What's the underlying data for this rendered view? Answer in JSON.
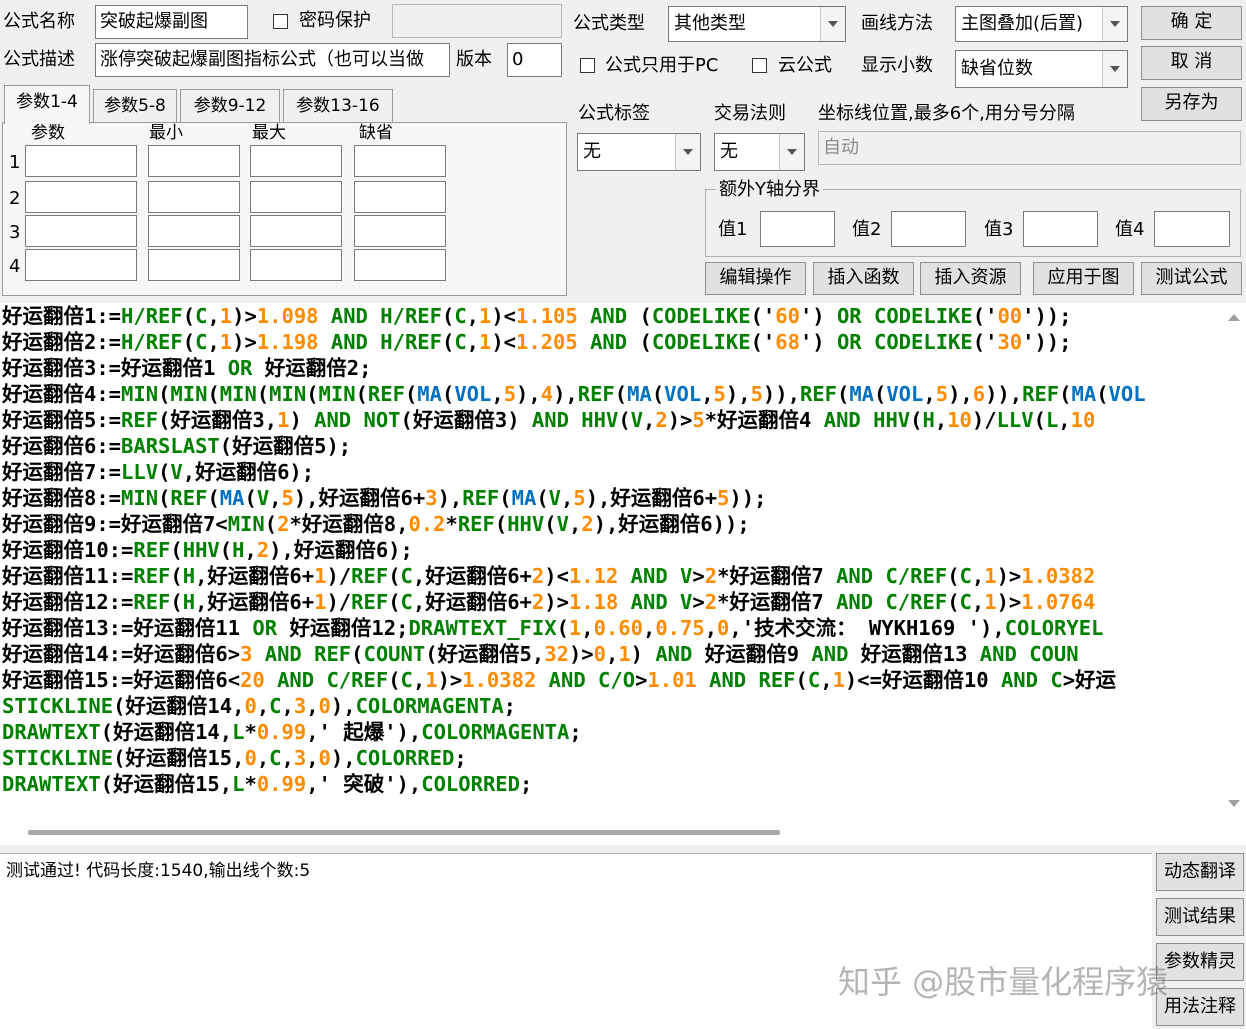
{
  "header": {
    "name_label": "公式名称",
    "name_value": "突破起爆副图",
    "password_label": "密码保护",
    "password_value": "",
    "desc_label": "公式描述",
    "desc_value": "涨停突破起爆副图指标公式（也可以当做",
    "version_label": "版本",
    "version_value": "0",
    "type_label": "公式类型",
    "type_value": "其他类型",
    "draw_label": "画线方法",
    "draw_value": "主图叠加(后置)",
    "pc_only_label": "公式只用于PC",
    "cloud_label": "云公式",
    "decimal_label": "显示小数",
    "decimal_value": "缺省位数",
    "confirm_label": "确  定",
    "cancel_label": "取  消",
    "saveas_label": "另存为"
  },
  "params": {
    "tabs": [
      "参数1-4",
      "参数5-8",
      "参数9-12",
      "参数13-16"
    ],
    "columns": [
      "参数",
      "最小",
      "最大",
      "缺省"
    ],
    "rows": [
      "1",
      "2",
      "3",
      "4"
    ]
  },
  "options": {
    "tag_label": "公式标签",
    "tag_value": "无",
    "rule_label": "交易法则",
    "rule_value": "无",
    "axis_label": "坐标线位置,最多6个,用分号分隔",
    "axis_value": "自动",
    "extra_group": "额外Y轴分界",
    "v1_label": "值1",
    "v2_label": "值2",
    "v3_label": "值3",
    "v4_label": "值4"
  },
  "toolbar": {
    "edit_label": "编辑操作",
    "insert_func_label": "插入函数",
    "insert_res_label": "插入资源",
    "apply_label": "应用于图",
    "test_label": "测试公式"
  },
  "code_lines": [
    [
      [
        "c",
        "好运翻倍1:="
      ],
      [
        "k",
        "H/"
      ],
      [
        "k",
        "REF"
      ],
      [
        "c",
        "("
      ],
      [
        "k",
        "C"
      ],
      [
        "c",
        ","
      ],
      [
        "n",
        "1"
      ],
      [
        "c",
        ")>"
      ],
      [
        "n",
        "1.098"
      ],
      [
        "k",
        " AND "
      ],
      [
        "k",
        "H/"
      ],
      [
        "k",
        "REF"
      ],
      [
        "c",
        "("
      ],
      [
        "k",
        "C"
      ],
      [
        "c",
        ","
      ],
      [
        "n",
        "1"
      ],
      [
        "c",
        ")<"
      ],
      [
        "n",
        "1.105"
      ],
      [
        "k",
        " AND "
      ],
      [
        "c",
        "("
      ],
      [
        "k",
        "CODELIKE"
      ],
      [
        "c",
        "('"
      ],
      [
        "n",
        "60"
      ],
      [
        "c",
        "')"
      ],
      [
        "k",
        " OR "
      ],
      [
        "k",
        "CODELIKE"
      ],
      [
        "c",
        "('"
      ],
      [
        "n",
        "00"
      ],
      [
        "c",
        "'));"
      ]
    ],
    [
      [
        "c",
        "好运翻倍2:="
      ],
      [
        "k",
        "H/"
      ],
      [
        "k",
        "REF"
      ],
      [
        "c",
        "("
      ],
      [
        "k",
        "C"
      ],
      [
        "c",
        ","
      ],
      [
        "n",
        "1"
      ],
      [
        "c",
        ")>"
      ],
      [
        "n",
        "1.198"
      ],
      [
        "k",
        " AND "
      ],
      [
        "k",
        "H/"
      ],
      [
        "k",
        "REF"
      ],
      [
        "c",
        "("
      ],
      [
        "k",
        "C"
      ],
      [
        "c",
        ","
      ],
      [
        "n",
        "1"
      ],
      [
        "c",
        ")<"
      ],
      [
        "n",
        "1.205"
      ],
      [
        "k",
        " AND "
      ],
      [
        "c",
        "("
      ],
      [
        "k",
        "CODELIKE"
      ],
      [
        "c",
        "('"
      ],
      [
        "n",
        "68"
      ],
      [
        "c",
        "')"
      ],
      [
        "k",
        " OR "
      ],
      [
        "k",
        "CODELIKE"
      ],
      [
        "c",
        "('"
      ],
      [
        "n",
        "30"
      ],
      [
        "c",
        "'));"
      ]
    ],
    [
      [
        "c",
        "好运翻倍3:=好运翻倍1"
      ],
      [
        "k",
        " OR "
      ],
      [
        "c",
        "好运翻倍2;"
      ]
    ],
    [
      [
        "c",
        "好运翻倍4:="
      ],
      [
        "k",
        "MIN"
      ],
      [
        "c",
        "("
      ],
      [
        "k",
        "MIN"
      ],
      [
        "c",
        "("
      ],
      [
        "k",
        "MIN"
      ],
      [
        "c",
        "("
      ],
      [
        "k",
        "MIN"
      ],
      [
        "c",
        "("
      ],
      [
        "k",
        "MIN"
      ],
      [
        "c",
        "("
      ],
      [
        "k",
        "REF"
      ],
      [
        "c",
        "("
      ],
      [
        "f",
        "MA"
      ],
      [
        "c",
        "("
      ],
      [
        "f",
        "VOL"
      ],
      [
        "c",
        ","
      ],
      [
        "n",
        "5"
      ],
      [
        "c",
        "),"
      ],
      [
        "n",
        "4"
      ],
      [
        "c",
        "),"
      ],
      [
        "k",
        "REF"
      ],
      [
        "c",
        "("
      ],
      [
        "f",
        "MA"
      ],
      [
        "c",
        "("
      ],
      [
        "f",
        "VOL"
      ],
      [
        "c",
        ","
      ],
      [
        "n",
        "5"
      ],
      [
        "c",
        "),"
      ],
      [
        "n",
        "5"
      ],
      [
        "c",
        "))"
      ],
      [
        "c",
        ","
      ],
      [
        "k",
        "REF"
      ],
      [
        "c",
        "("
      ],
      [
        "f",
        "MA"
      ],
      [
        "c",
        "("
      ],
      [
        "f",
        "VOL"
      ],
      [
        "c",
        ","
      ],
      [
        "n",
        "5"
      ],
      [
        "c",
        "),"
      ],
      [
        "n",
        "6"
      ],
      [
        "c",
        "))"
      ],
      [
        "c",
        ","
      ],
      [
        "k",
        "REF"
      ],
      [
        "c",
        "("
      ],
      [
        "f",
        "MA"
      ],
      [
        "c",
        "("
      ],
      [
        "f",
        "VOL"
      ]
    ],
    [
      [
        "c",
        "好运翻倍5:="
      ],
      [
        "k",
        "REF"
      ],
      [
        "c",
        "(好运翻倍3,"
      ],
      [
        "n",
        "1"
      ],
      [
        "c",
        ")"
      ],
      [
        "k",
        " AND NOT"
      ],
      [
        "c",
        "(好运翻倍3)"
      ],
      [
        "k",
        " AND "
      ],
      [
        "k",
        "HHV"
      ],
      [
        "c",
        "("
      ],
      [
        "k",
        "V"
      ],
      [
        "c",
        ","
      ],
      [
        "n",
        "2"
      ],
      [
        "c",
        ")>"
      ],
      [
        "n",
        "5"
      ],
      [
        "c",
        "*好运翻倍4"
      ],
      [
        "k",
        " AND "
      ],
      [
        "k",
        "HHV"
      ],
      [
        "c",
        "("
      ],
      [
        "k",
        "H"
      ],
      [
        "c",
        ","
      ],
      [
        "n",
        "10"
      ],
      [
        "c",
        ")/"
      ],
      [
        "k",
        "LLV"
      ],
      [
        "c",
        "("
      ],
      [
        "k",
        "L"
      ],
      [
        "c",
        ","
      ],
      [
        "n",
        "10"
      ]
    ],
    [
      [
        "c",
        "好运翻倍6:="
      ],
      [
        "k",
        "BARSLAST"
      ],
      [
        "c",
        "(好运翻倍5);"
      ]
    ],
    [
      [
        "c",
        "好运翻倍7:="
      ],
      [
        "k",
        "LLV"
      ],
      [
        "c",
        "("
      ],
      [
        "k",
        "V"
      ],
      [
        "c",
        ",好运翻倍6);"
      ]
    ],
    [
      [
        "c",
        "好运翻倍8:="
      ],
      [
        "k",
        "MIN"
      ],
      [
        "c",
        "("
      ],
      [
        "k",
        "REF"
      ],
      [
        "c",
        "("
      ],
      [
        "f",
        "MA"
      ],
      [
        "c",
        "("
      ],
      [
        "k",
        "V"
      ],
      [
        "c",
        ","
      ],
      [
        "n",
        "5"
      ],
      [
        "c",
        "),好运翻倍6+"
      ],
      [
        "n",
        "3"
      ],
      [
        "c",
        "),"
      ],
      [
        "k",
        "REF"
      ],
      [
        "c",
        "("
      ],
      [
        "f",
        "MA"
      ],
      [
        "c",
        "("
      ],
      [
        "k",
        "V"
      ],
      [
        "c",
        ","
      ],
      [
        "n",
        "5"
      ],
      [
        "c",
        "),好运翻倍6+"
      ],
      [
        "n",
        "5"
      ],
      [
        "c",
        "));"
      ]
    ],
    [
      [
        "c",
        "好运翻倍9:=好运翻倍7<"
      ],
      [
        "k",
        "MIN"
      ],
      [
        "c",
        "("
      ],
      [
        "n",
        "2"
      ],
      [
        "c",
        "*好运翻倍8,"
      ],
      [
        "n",
        "0.2"
      ],
      [
        "c",
        "*"
      ],
      [
        "k",
        "REF"
      ],
      [
        "c",
        "("
      ],
      [
        "k",
        "HHV"
      ],
      [
        "c",
        "("
      ],
      [
        "k",
        "V"
      ],
      [
        "c",
        ","
      ],
      [
        "n",
        "2"
      ],
      [
        "c",
        "),好运翻倍6));"
      ]
    ],
    [
      [
        "c",
        "好运翻倍10:="
      ],
      [
        "k",
        "REF"
      ],
      [
        "c",
        "("
      ],
      [
        "k",
        "HHV"
      ],
      [
        "c",
        "("
      ],
      [
        "k",
        "H"
      ],
      [
        "c",
        ","
      ],
      [
        "n",
        "2"
      ],
      [
        "c",
        "),好运翻倍6);"
      ]
    ],
    [
      [
        "c",
        "好运翻倍11:="
      ],
      [
        "k",
        "REF"
      ],
      [
        "c",
        "("
      ],
      [
        "k",
        "H"
      ],
      [
        "c",
        ",好运翻倍6+"
      ],
      [
        "n",
        "1"
      ],
      [
        "c",
        ")/"
      ],
      [
        "k",
        "REF"
      ],
      [
        "c",
        "("
      ],
      [
        "k",
        "C"
      ],
      [
        "c",
        ",好运翻倍6+"
      ],
      [
        "n",
        "2"
      ],
      [
        "c",
        ")<"
      ],
      [
        "n",
        "1.12"
      ],
      [
        "k",
        " AND "
      ],
      [
        "k",
        "V"
      ],
      [
        "c",
        ">"
      ],
      [
        "n",
        "2"
      ],
      [
        "c",
        "*好运翻倍7"
      ],
      [
        "k",
        " AND "
      ],
      [
        "k",
        "C/"
      ],
      [
        "k",
        "REF"
      ],
      [
        "c",
        "("
      ],
      [
        "k",
        "C"
      ],
      [
        "c",
        ","
      ],
      [
        "n",
        "1"
      ],
      [
        "c",
        ")>"
      ],
      [
        "n",
        "1.0382"
      ]
    ],
    [
      [
        "c",
        "好运翻倍12:="
      ],
      [
        "k",
        "REF"
      ],
      [
        "c",
        "("
      ],
      [
        "k",
        "H"
      ],
      [
        "c",
        ",好运翻倍6+"
      ],
      [
        "n",
        "1"
      ],
      [
        "c",
        ")/"
      ],
      [
        "k",
        "REF"
      ],
      [
        "c",
        "("
      ],
      [
        "k",
        "C"
      ],
      [
        "c",
        ",好运翻倍6+"
      ],
      [
        "n",
        "2"
      ],
      [
        "c",
        ")>"
      ],
      [
        "n",
        "1.18"
      ],
      [
        "k",
        " AND "
      ],
      [
        "k",
        "V"
      ],
      [
        "c",
        ">"
      ],
      [
        "n",
        "2"
      ],
      [
        "c",
        "*好运翻倍7"
      ],
      [
        "k",
        " AND "
      ],
      [
        "k",
        "C/"
      ],
      [
        "k",
        "REF"
      ],
      [
        "c",
        "("
      ],
      [
        "k",
        "C"
      ],
      [
        "c",
        ","
      ],
      [
        "n",
        "1"
      ],
      [
        "c",
        ")>"
      ],
      [
        "n",
        "1.0764"
      ]
    ],
    [
      [
        "c",
        "好运翻倍13:=好运翻倍11"
      ],
      [
        "k",
        " OR "
      ],
      [
        "c",
        "好运翻倍12;"
      ],
      [
        "k",
        "DRAWTEXT_FIX"
      ],
      [
        "c",
        "("
      ],
      [
        "n",
        "1"
      ],
      [
        "c",
        ","
      ],
      [
        "n",
        "0.60"
      ],
      [
        "c",
        ","
      ],
      [
        "n",
        "0.75"
      ],
      [
        "c",
        ","
      ],
      [
        "n",
        "0"
      ],
      [
        "c",
        ",'技术交流： WYKH169 '),"
      ],
      [
        "k",
        "COLORYEL"
      ]
    ],
    [
      [
        "c",
        "好运翻倍14:=好运翻倍6>"
      ],
      [
        "n",
        "3"
      ],
      [
        "k",
        " AND "
      ],
      [
        "k",
        "REF"
      ],
      [
        "c",
        "("
      ],
      [
        "k",
        "COUNT"
      ],
      [
        "c",
        "(好运翻倍5,"
      ],
      [
        "n",
        "32"
      ],
      [
        "c",
        ")>"
      ],
      [
        "n",
        "0"
      ],
      [
        "c",
        ","
      ],
      [
        "n",
        "1"
      ],
      [
        "c",
        ")"
      ],
      [
        "k",
        " AND "
      ],
      [
        "c",
        "好运翻倍9"
      ],
      [
        "k",
        " AND "
      ],
      [
        "c",
        "好运翻倍13"
      ],
      [
        "k",
        " AND "
      ],
      [
        "k",
        "COUN"
      ]
    ],
    [
      [
        "c",
        "好运翻倍15:=好运翻倍6<"
      ],
      [
        "n",
        "20"
      ],
      [
        "k",
        " AND "
      ],
      [
        "k",
        "C/"
      ],
      [
        "k",
        "REF"
      ],
      [
        "c",
        "("
      ],
      [
        "k",
        "C"
      ],
      [
        "c",
        ","
      ],
      [
        "n",
        "1"
      ],
      [
        "c",
        ")>"
      ],
      [
        "n",
        "1.0382"
      ],
      [
        "k",
        " AND "
      ],
      [
        "k",
        "C/O"
      ],
      [
        "c",
        ">"
      ],
      [
        "n",
        "1.01"
      ],
      [
        "k",
        " AND "
      ],
      [
        "k",
        "REF"
      ],
      [
        "c",
        "("
      ],
      [
        "k",
        "C"
      ],
      [
        "c",
        ","
      ],
      [
        "n",
        "1"
      ],
      [
        "c",
        ")<=好运翻倍10"
      ],
      [
        "k",
        " AND "
      ],
      [
        "k",
        "C"
      ],
      [
        "c",
        ">好运"
      ]
    ],
    [
      [
        "k",
        "STICKLINE"
      ],
      [
        "c",
        "(好运翻倍14,"
      ],
      [
        "n",
        "0"
      ],
      [
        "c",
        ","
      ],
      [
        "k",
        "C"
      ],
      [
        "c",
        ","
      ],
      [
        "n",
        "3"
      ],
      [
        "c",
        ","
      ],
      [
        "n",
        "0"
      ],
      [
        "c",
        "),"
      ],
      [
        "k",
        "COLORMAGENTA"
      ],
      [
        "c",
        ";"
      ]
    ],
    [
      [
        "k",
        "DRAWTEXT"
      ],
      [
        "c",
        "(好运翻倍14,"
      ],
      [
        "k",
        "L"
      ],
      [
        "c",
        "*"
      ],
      [
        "n",
        "0.99"
      ],
      [
        "c",
        ",' 起爆'),"
      ],
      [
        "k",
        "COLORMAGENTA"
      ],
      [
        "c",
        ";"
      ]
    ],
    [
      [
        "k",
        "STICKLINE"
      ],
      [
        "c",
        "(好运翻倍15,"
      ],
      [
        "n",
        "0"
      ],
      [
        "c",
        ","
      ],
      [
        "k",
        "C"
      ],
      [
        "c",
        ","
      ],
      [
        "n",
        "3"
      ],
      [
        "c",
        ","
      ],
      [
        "n",
        "0"
      ],
      [
        "c",
        "),"
      ],
      [
        "k",
        "COLORRED"
      ],
      [
        "c",
        ";"
      ]
    ],
    [
      [
        "k",
        "DRAWTEXT"
      ],
      [
        "c",
        "(好运翻倍15,"
      ],
      [
        "k",
        "L"
      ],
      [
        "c",
        "*"
      ],
      [
        "n",
        "0.99"
      ],
      [
        "c",
        ",' 突破'),"
      ],
      [
        "k",
        "COLORRED"
      ],
      [
        "c",
        ";"
      ]
    ]
  ],
  "status": {
    "message": "测试通过! 代码长度:1540,输出线个数:5"
  },
  "sidebar": {
    "dynamic_label": "动态翻译",
    "result_label": "测试结果",
    "wizard_label": "参数精灵",
    "usage_label": "用法注释"
  },
  "watermark": "知乎 @股市量化程序猿"
}
